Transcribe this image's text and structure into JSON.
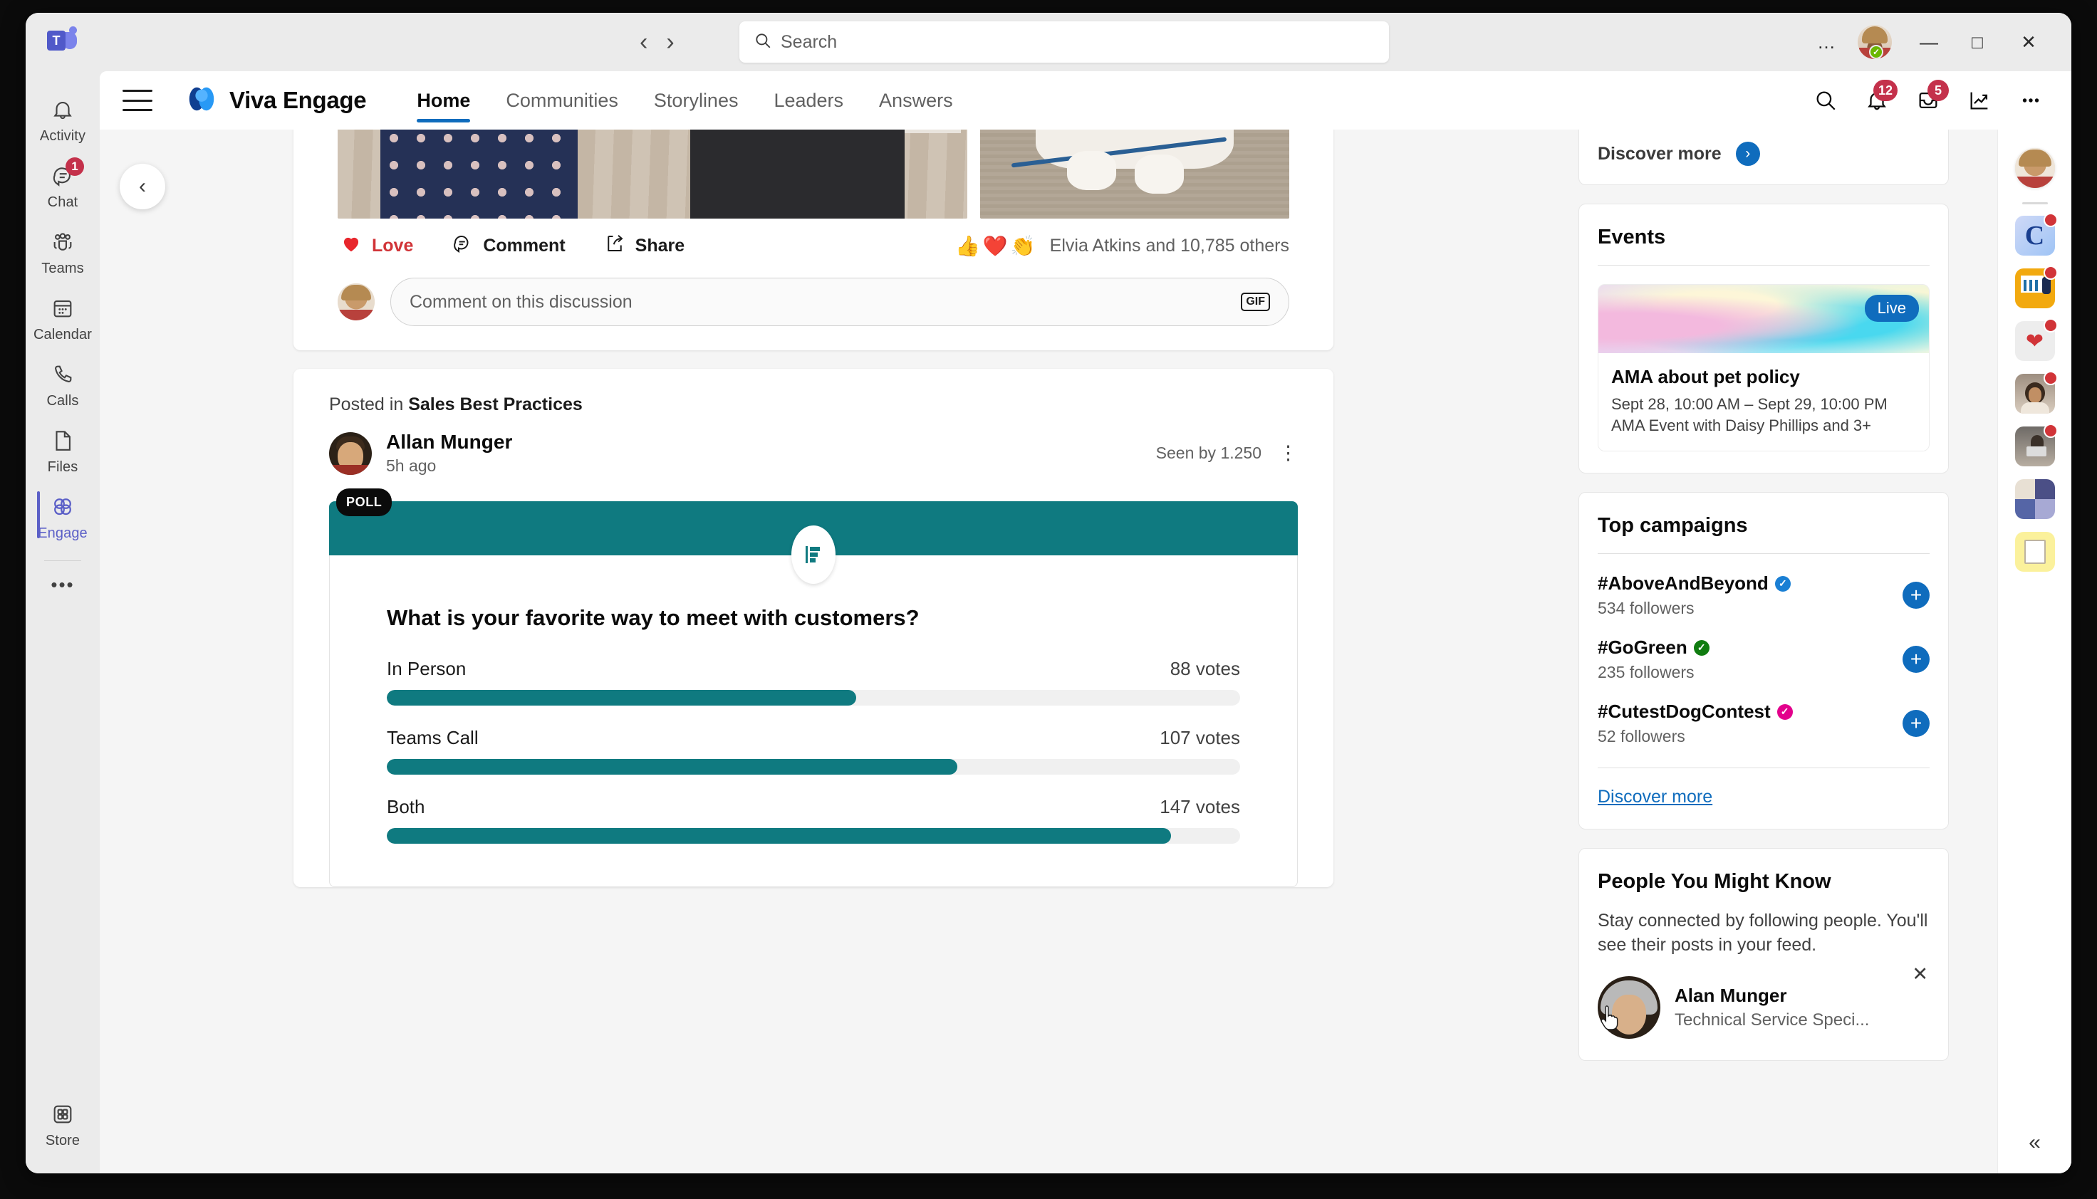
{
  "window": {
    "app_logo": "teams-logo",
    "nav_back": "‹",
    "nav_forward": "›",
    "search_placeholder": "Search",
    "more_options": "…",
    "minimize": "—",
    "maximize": "□",
    "close": "✕",
    "presence_status": "available"
  },
  "rail": {
    "items": [
      {
        "label": "Activity",
        "icon": "bell-icon",
        "badge": null,
        "active": false
      },
      {
        "label": "Chat",
        "icon": "chat-icon",
        "badge": "1",
        "active": false
      },
      {
        "label": "Teams",
        "icon": "teams-icon",
        "badge": null,
        "active": false
      },
      {
        "label": "Calendar",
        "icon": "calendar-icon",
        "badge": null,
        "active": false
      },
      {
        "label": "Calls",
        "icon": "phone-icon",
        "badge": null,
        "active": false
      },
      {
        "label": "Files",
        "icon": "file-icon",
        "badge": null,
        "active": false
      },
      {
        "label": "Engage",
        "icon": "engage-icon",
        "badge": null,
        "active": true
      }
    ],
    "more": "•••",
    "store_label": "Store"
  },
  "engage_header": {
    "menu": "hamburger-icon",
    "brand": "Viva Engage",
    "tabs": [
      {
        "label": "Home",
        "active": true
      },
      {
        "label": "Communities",
        "active": false
      },
      {
        "label": "Storylines",
        "active": false
      },
      {
        "label": "Leaders",
        "active": false
      },
      {
        "label": "Answers",
        "active": false
      }
    ],
    "actions": [
      {
        "name": "search-icon",
        "badge": null
      },
      {
        "name": "notifications-bell-icon",
        "badge": "12"
      },
      {
        "name": "inbox-icon",
        "badge": "5"
      },
      {
        "name": "analytics-icon",
        "badge": null
      },
      {
        "name": "more-icon",
        "badge": null
      }
    ]
  },
  "feed": {
    "collapse_left": "‹",
    "post1": {
      "reactions": {
        "love_label": "Love",
        "comment_label": "Comment",
        "share_label": "Share",
        "emojis": [
          "👍",
          "❤️",
          "👏"
        ],
        "summary": "Elvia Atkins and 10,785 others"
      },
      "comment_placeholder": "Comment on this discussion",
      "gif_label": "GIF"
    },
    "post2": {
      "posted_in_prefix": "Posted in ",
      "community": "Sales Best Practices",
      "author": "Allan Munger",
      "timestamp": "5h ago",
      "seen_by": "Seen by 1.250",
      "kebab": "⋮",
      "poll": {
        "badge": "POLL",
        "question": "What is your favorite way to meet with customers?",
        "options": [
          {
            "label": "In Person",
            "votes_text": "88 votes",
            "votes": 88
          },
          {
            "label": "Teams Call",
            "votes_text": "107 votes",
            "votes": 107
          },
          {
            "label": "Both",
            "votes_text": "147 votes",
            "votes": 147
          }
        ],
        "max_votes": 160,
        "accent_color": "#0f7a80"
      }
    }
  },
  "right_panel": {
    "discover_more_top": "Discover more",
    "events": {
      "title": "Events",
      "live_badge": "Live",
      "name": "AMA about pet policy",
      "when": "Sept 28, 10:00 AM – Sept 29, 10:00 PM",
      "host": "AMA Event with Daisy Phillips and 3+"
    },
    "campaigns": {
      "title": "Top campaigns",
      "items": [
        {
          "name": "#AboveAndBeyond",
          "followers": "534 followers",
          "badge_color": "#1a7fd4",
          "add": "+"
        },
        {
          "name": "#GoGreen",
          "followers": "235 followers",
          "badge_color": "#107c10",
          "add": "+"
        },
        {
          "name": "#CutestDogContest",
          "followers": "52 followers",
          "badge_color": "#e3008c",
          "add": "+"
        }
      ],
      "discover_more": "Discover more"
    },
    "pymk": {
      "title": "People You Might Know",
      "description": "Stay connected by following people. You'll see their posts in your feed.",
      "person_name": "Alan Munger",
      "person_role": "Technical Service Speci...",
      "dismiss": "✕"
    }
  },
  "far_rail": {
    "collapse": "«",
    "apps": [
      {
        "name": "avatar",
        "badge": false
      },
      {
        "name": "app-icon-c",
        "badge": true
      },
      {
        "name": "app-icon-presentation",
        "badge": true
      },
      {
        "name": "app-icon-praise-heart",
        "badge": true
      },
      {
        "name": "app-icon-person-photo",
        "badge": true
      },
      {
        "name": "app-icon-meeting-photo",
        "badge": true
      },
      {
        "name": "app-icon-people-grid",
        "badge": false
      },
      {
        "name": "app-icon-documents",
        "badge": false
      }
    ]
  }
}
